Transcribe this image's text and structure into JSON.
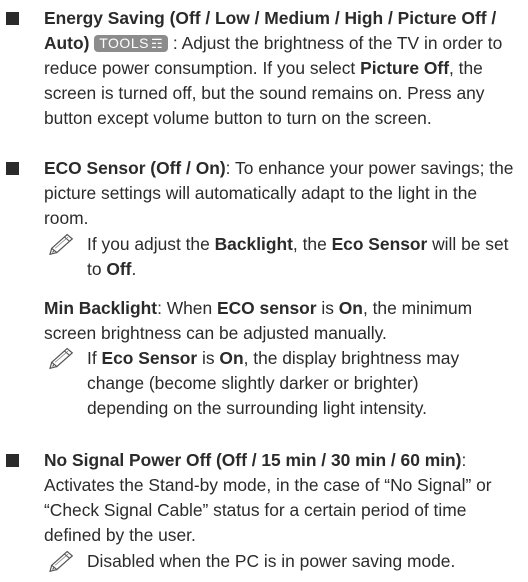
{
  "sections": {
    "energy": {
      "title": "Energy Saving (Off / Low / Medium / High / Picture Off / Auto)",
      "tools_label": "TOOLS",
      "tools_icon": "☶",
      "desc_before": " : Adjust the brightness of the TV in order to reduce power consumption. If you select ",
      "picture_off": "Picture Off",
      "desc_after": ", the screen is turned off, but the sound remains on. Press any button except volume button to turn on the screen."
    },
    "eco": {
      "title": "ECO Sensor (Off / On)",
      "desc": ": To enhance your power savings; the picture settings will automatically adapt to the light in the room.",
      "note": {
        "p1": "If you adjust the ",
        "backlight": "Backlight",
        "p2": ", the ",
        "eco_sensor": "Eco Sensor",
        "p3": " will be set to ",
        "off": "Off",
        "p4": "."
      },
      "min_backlight": {
        "title": "Min Backlight",
        "p1": ": When ",
        "eco_sensor": "ECO sensor",
        "p2": " is ",
        "on": "On",
        "p3": ", the minimum screen brightness can be adjusted manually."
      },
      "note2": {
        "p1": "If ",
        "eco_sensor": "Eco Sensor",
        "p2": " is ",
        "on": "On",
        "p3": ", the display brightness may change (become slightly darker or brighter) depending on the surrounding light intensity."
      }
    },
    "nosignal": {
      "title": "No Signal Power Off (Off / 15 min / 30 min / 60 min)",
      "desc": ": Activates the Stand-by mode, in the case of “No Signal” or “Check Signal Cable” status for a certain period of time defined by the user.",
      "note": "Disabled when the PC is in power saving mode."
    }
  }
}
